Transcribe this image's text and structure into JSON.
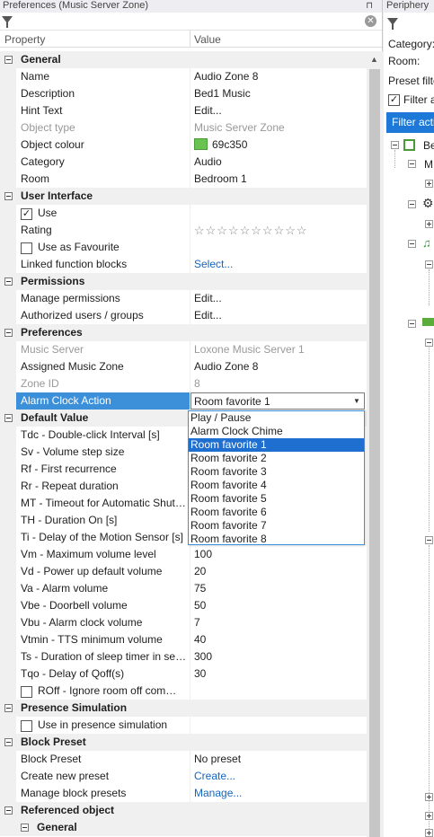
{
  "window_title": "Preferences (Music Server Zone)",
  "pin_glyph": "⊓",
  "columns": {
    "property": "Property",
    "value": "Value"
  },
  "sections": {
    "general": "General",
    "user_interface": "User Interface",
    "permissions": "Permissions",
    "preferences": "Preferences",
    "default_value": "Default Value",
    "presence_simulation": "Presence Simulation",
    "block_preset": "Block Preset",
    "referenced_object": "Referenced object",
    "referenced_general": "General"
  },
  "general": {
    "name": {
      "label": "Name",
      "value": "Audio Zone 8"
    },
    "description": {
      "label": "Description",
      "value": "Bed1 Music"
    },
    "hint_text": {
      "label": "Hint Text",
      "value": "Edit..."
    },
    "object_type": {
      "label": "Object type",
      "value": "Music Server Zone"
    },
    "object_colour": {
      "label": "Object colour",
      "value": "69c350",
      "color": "#69c350"
    },
    "category": {
      "label": "Category",
      "value": "Audio"
    },
    "room": {
      "label": "Room",
      "value": "Bedroom 1"
    }
  },
  "user_interface": {
    "use": {
      "label": "Use",
      "checked": true
    },
    "rating": {
      "label": "Rating",
      "stars": "☆☆☆☆☆☆☆☆☆☆"
    },
    "favourite": {
      "label": "Use as Favourite",
      "checked": false
    },
    "linked": {
      "label": "Linked function blocks",
      "value": "Select..."
    }
  },
  "permissions": {
    "manage": {
      "label": "Manage permissions",
      "value": "Edit..."
    },
    "authorized": {
      "label": "Authorized users / groups",
      "value": "Edit..."
    }
  },
  "preferences": {
    "music_server": {
      "label": "Music Server",
      "value": "Loxone Music Server 1"
    },
    "assigned_zone": {
      "label": "Assigned Music Zone",
      "value": "Audio Zone 8"
    },
    "zone_id": {
      "label": "Zone ID",
      "value": "8"
    },
    "alarm_action": {
      "label": "Alarm Clock Action",
      "value": "Room favorite 1"
    }
  },
  "dropdown_options": [
    "Play / Pause",
    "Alarm Clock Chime",
    "Room favorite 1",
    "Room favorite 2",
    "Room favorite 3",
    "Room favorite 4",
    "Room favorite 5",
    "Room favorite 6",
    "Room favorite 7",
    "Room favorite 8"
  ],
  "default_values": [
    {
      "label": "Tdc - Double-click Interval [s]",
      "value": ""
    },
    {
      "label": "Sv - Volume step size",
      "value": ""
    },
    {
      "label": "Rf - First recurrence",
      "value": ""
    },
    {
      "label": "Rr - Repeat duration",
      "value": ""
    },
    {
      "label": "MT - Timeout for Automatic Shutdown",
      "value": ""
    },
    {
      "label": "TH - Duration On [s]",
      "value": ""
    },
    {
      "label": "Ti - Delay of the Motion Sensor [s]",
      "value": ""
    },
    {
      "label": "Vm - Maximum volume level",
      "value": "100"
    },
    {
      "label": "Vd - Power up default volume",
      "value": "20"
    },
    {
      "label": "Va - Alarm volume",
      "value": "75"
    },
    {
      "label": "Vbe - Doorbell volume",
      "value": "50"
    },
    {
      "label": "Vbu - Alarm clock volume",
      "value": "7"
    },
    {
      "label": "Vtmin - TTS minimum volume",
      "value": "40"
    },
    {
      "label": "Ts - Duration of sleep timer in seconds",
      "value": "300"
    },
    {
      "label": "Tqo - Delay of Qoff(s)",
      "value": "30"
    }
  ],
  "roff": {
    "label": "ROff - Ignore room off commands",
    "checked": false
  },
  "presence": {
    "label": "Use in presence simulation",
    "checked": false
  },
  "block_preset": {
    "preset": {
      "label": "Block Preset",
      "value": "No preset"
    },
    "create": {
      "label": "Create new preset",
      "value": "Create..."
    },
    "manage": {
      "label": "Manage block presets",
      "value": "Manage..."
    }
  },
  "periphery": {
    "title": "Periphery",
    "category_label": "Category:",
    "room_label": "Room:",
    "preset_filter": "Preset filte",
    "filter_a": "Filter a",
    "filter_active": "Filter activ",
    "tree_root": "Be",
    "tree_child": "M"
  },
  "accent_color": "#3c8fd9"
}
